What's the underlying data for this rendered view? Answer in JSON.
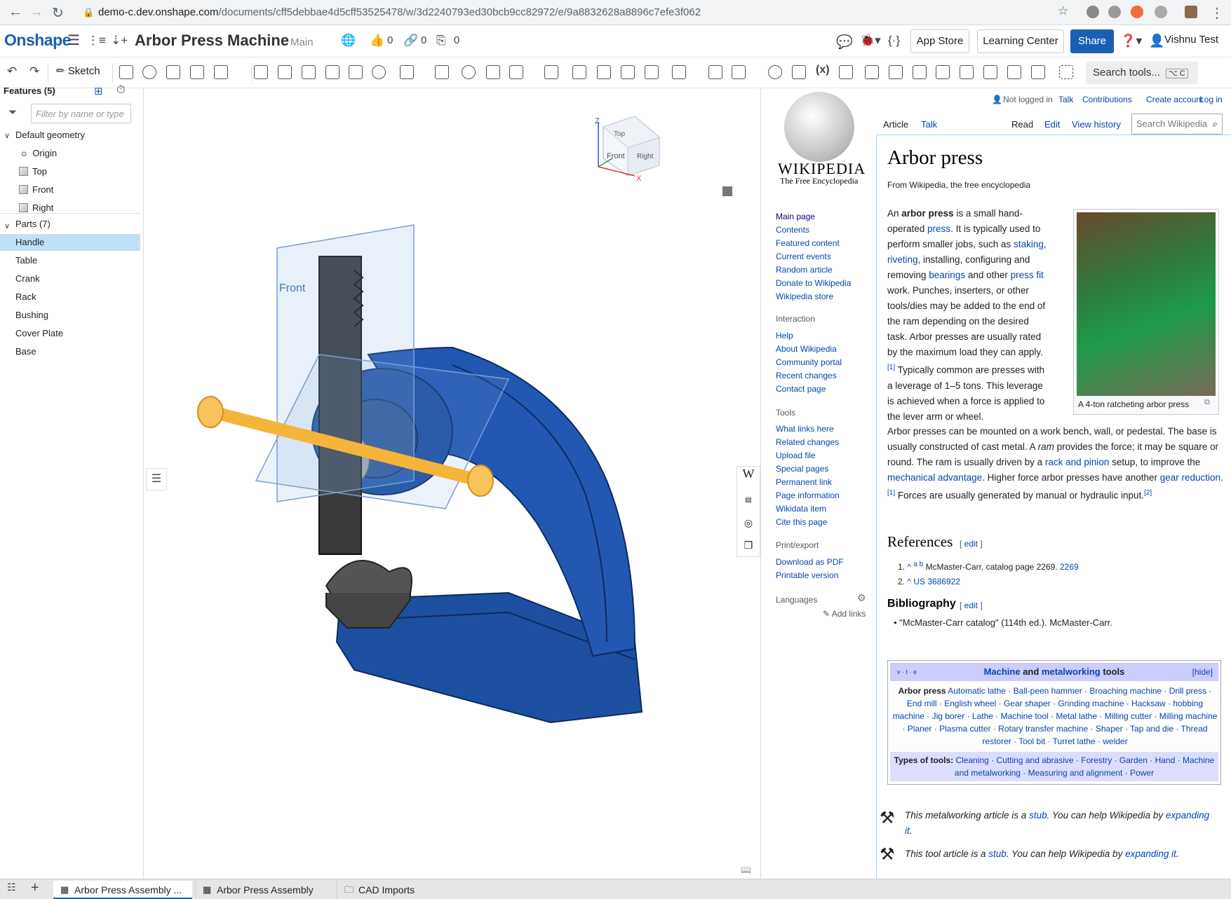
{
  "browser": {
    "url_host": "demo-c.dev.onshape.com",
    "url_path": "/documents/cff5debbae4d5cff53525478/w/3d2240793ed30bcb9cc82972/e/9a8832628a8896c7efe3f062"
  },
  "header": {
    "logo": "Onshape",
    "doc_name": "Arbor Press Machine",
    "branch": "Main",
    "likes": "0",
    "links": "0",
    "copies": "0",
    "app_store": "App Store",
    "learning_center": "Learning Center",
    "share": "Share",
    "user": "Vishnu Test"
  },
  "toolbar": {
    "sketch_label": "Sketch",
    "search_tools": "Search tools...",
    "search_shortcut": "⌥ C"
  },
  "features": {
    "title": "Features (5)",
    "filter_placeholder": "Filter by name or type",
    "default_geometry": "Default geometry",
    "geometry": [
      "Origin",
      "Top",
      "Front",
      "Right"
    ],
    "parts_title": "Parts (7)",
    "parts": [
      "Handle",
      "Table",
      "Crank",
      "Rack",
      "Bushing",
      "Cover Plate",
      "Base"
    ],
    "selected_part": "Handle"
  },
  "viewcube": {
    "top": "Top",
    "front": "Front",
    "right": "Right",
    "axis_z": "Z",
    "axis_x": "X"
  },
  "viewport": {
    "plane_label": "Front",
    "colors": {
      "part_blue": "#1d4fa0",
      "handle": "#f5b43a",
      "rack": "#3a3a3a"
    }
  },
  "wiki": {
    "not_logged_in": "Not logged in",
    "talk": "Talk",
    "contributions": "Contributions",
    "create_account": "Create account",
    "log_in": "Log in",
    "wordmark": "Wikipedia",
    "tagline": "The Free Encyclopedia",
    "tab_article": "Article",
    "tab_talk": "Talk",
    "tab_read": "Read",
    "tab_edit": "Edit",
    "tab_history": "View history",
    "search_placeholder": "Search Wikipedia",
    "nav": [
      "Main page",
      "Contents",
      "Featured content",
      "Current events",
      "Random article",
      "Donate to Wikipedia",
      "Wikipedia store"
    ],
    "interaction_title": "Interaction",
    "interaction": [
      "Help",
      "About Wikipedia",
      "Community portal",
      "Recent changes",
      "Contact page"
    ],
    "tools_title": "Tools",
    "tools": [
      "What links here",
      "Related changes",
      "Upload file",
      "Special pages",
      "Permanent link",
      "Page information",
      "Wikidata item",
      "Cite this page"
    ],
    "print_title": "Print/export",
    "print": [
      "Download as PDF",
      "Printable version"
    ],
    "languages_title": "Languages",
    "add_links": "Add links",
    "title": "Arbor press",
    "from": "From Wikipedia, the free encyclopedia",
    "caption": "A 4-ton ratcheting arbor press",
    "references_title": "References",
    "edit": "edit",
    "ref1": "McMaster-Carr, catalog page 2269.",
    "ref1_link": "2269",
    "ref2": "US 3686922",
    "bibliography_title": "Bibliography",
    "bib1": "\"McMaster-Carr catalog\" (114th ed.). McMaster-Carr.",
    "navbox_vte": "v · t · e",
    "navbox_title_1": "Machine",
    "navbox_title_2": " and ",
    "navbox_title_3": "metalworking",
    "navbox_title_4": " tools",
    "navbox_hide": "[hide]",
    "navbox_lead": "Arbor press",
    "navbox_items": "Automatic lathe · Ball-peen hammer · Broaching machine · Drill press · End mill · English wheel · Gear shaper · Grinding machine · Hacksaw · hobbing machine · Jig borer · Lathe · Machine tool · Metal lathe · Milling cutter · Milling machine · Planer · Plasma cutter · Rotary transfer machine · Shaper · Tap and die · Thread restorer · Tool bit · Turret lathe · welder",
    "types_label": "Types of tools:",
    "types_items": "Cleaning · Cutting and abrasive · Forestry · Garden · Hand · Machine and metalworking · Measuring and alignment · Power",
    "stub1_pre": "This metalworking article is a ",
    "stub1_link": "stub",
    "stub1_mid": ". You can help Wikipedia by ",
    "stub1_link2": "expanding it",
    "stub2_pre": "This tool article is a ",
    "stub2_link": "stub",
    "stub2_mid": ". You can help Wikipedia by ",
    "stub2_link2": "expanding it"
  },
  "bottom_tabs": [
    "Arbor Press Assembly ...",
    "Arbor Press Assembly",
    "CAD Imports"
  ]
}
